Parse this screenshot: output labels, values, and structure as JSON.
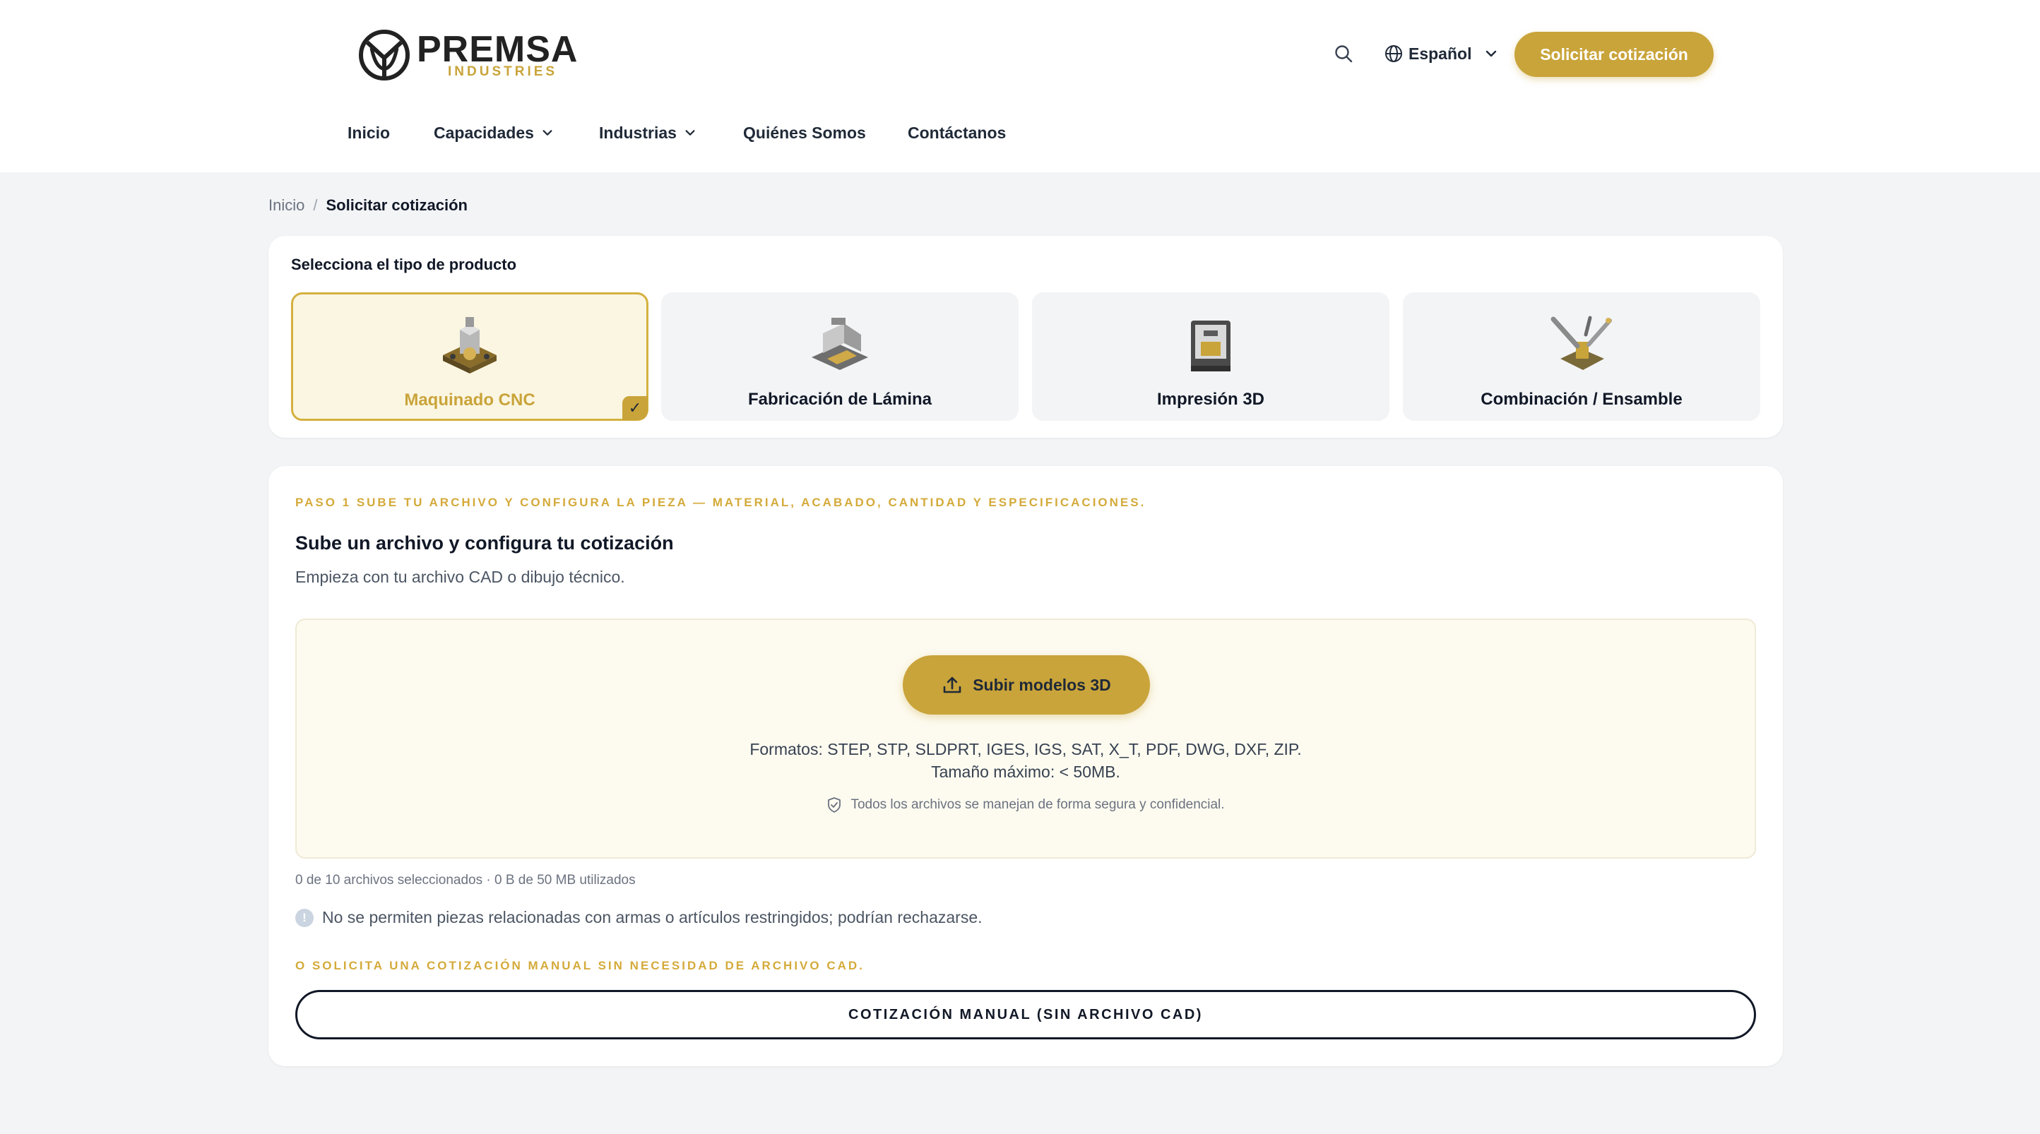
{
  "header": {
    "logo_name": "PREMSA",
    "logo_sub": "INDUSTRIES",
    "language": "Español",
    "cta_label": "Solicitar cotización",
    "nav": [
      {
        "label": "Inicio",
        "has_dropdown": false
      },
      {
        "label": "Capacidades",
        "has_dropdown": true
      },
      {
        "label": "Industrias",
        "has_dropdown": true
      },
      {
        "label": "Quiénes Somos",
        "has_dropdown": false
      },
      {
        "label": "Contáctanos",
        "has_dropdown": false
      }
    ]
  },
  "breadcrumb": {
    "home": "Inicio",
    "separator": "/",
    "current": "Solicitar cotización"
  },
  "product_type": {
    "title": "Selecciona el tipo de producto",
    "options": [
      {
        "label": "Maquinado CNC",
        "icon": "cnc-part-icon",
        "selected": true
      },
      {
        "label": "Fabricación de Lámina",
        "icon": "sheet-metal-icon",
        "selected": false
      },
      {
        "label": "Impresión 3D",
        "icon": "3d-printer-icon",
        "selected": false
      },
      {
        "label": "Combinación / Ensamble",
        "icon": "assembly-tools-icon",
        "selected": false
      }
    ],
    "check_mark": "✓"
  },
  "upload": {
    "step_text": "PASO 1 SUBE TU ARCHIVO Y CONFIGURA LA PIEZA — MATERIAL, ACABADO, CANTIDAD Y ESPECIFICACIONES.",
    "title": "Sube un archivo y configura tu cotización",
    "subtitle": "Empieza con tu archivo CAD o dibujo técnico.",
    "button_label": "Subir modelos 3D",
    "formats": "Formatos: STEP, STP, SLDPRT, IGES, IGS, SAT, X_T, PDF, DWG, DXF, ZIP.",
    "max_size": "Tamaño máximo: < 50MB.",
    "secure_note": "Todos los archivos se manejan de forma segura y confidencial.",
    "counter": "0 de 10 archivos seleccionados · 0 B de 50 MB utilizados",
    "warning": "No se permiten piezas relacionadas con armas o artículos restringidos; podrían rechazarse.",
    "warning_icon_glyph": "!",
    "or_text": "O SOLICITA UNA COTIZACIÓN MANUAL SIN NECESIDAD DE ARCHIVO CAD.",
    "manual_button": "COTIZACIÓN MANUAL (SIN ARCHIVO CAD)"
  },
  "colors": {
    "accent": "#c9a43a",
    "page_bg": "#f3f4f6",
    "selected_bg": "#fbf6e2",
    "dropzone_bg": "#fdfbf0"
  }
}
